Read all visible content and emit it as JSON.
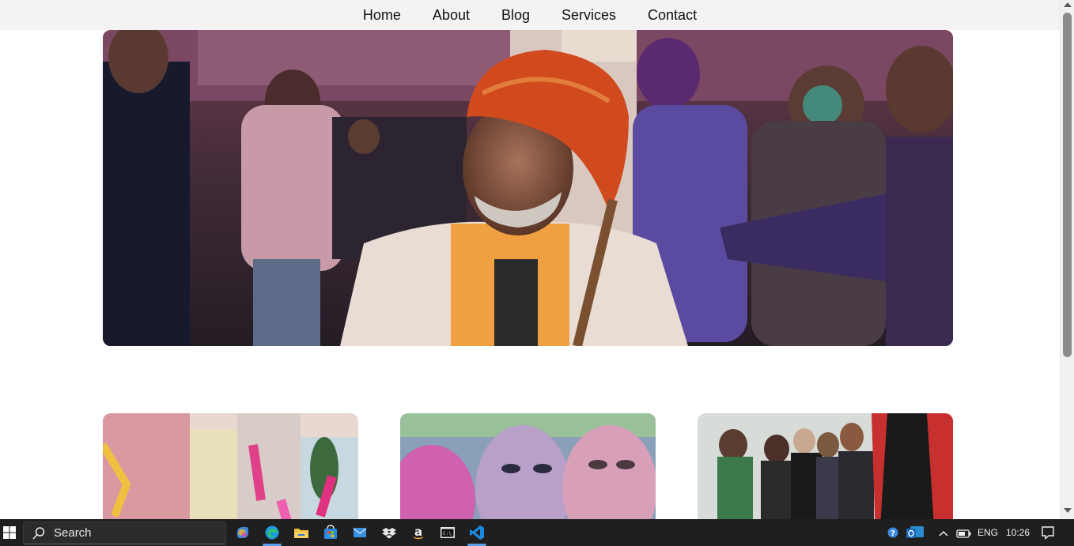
{
  "nav": {
    "items": [
      "Home",
      "About",
      "Blog",
      "Services",
      "Contact"
    ]
  },
  "taskbar": {
    "search_label": "Search",
    "language": "ENG",
    "time": "10:26"
  },
  "colors": {
    "nav_bg": "#f3f3f3",
    "taskbar_bg": "#1f1f1f"
  }
}
